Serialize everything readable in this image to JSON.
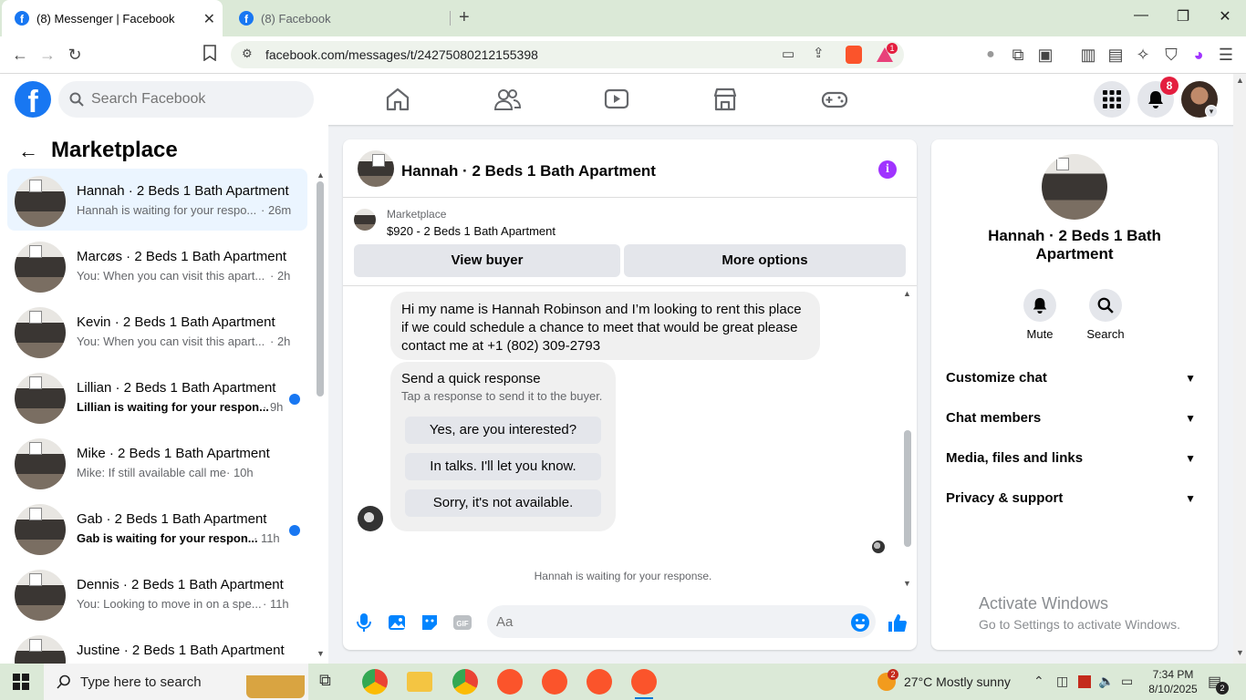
{
  "browser": {
    "tabs": [
      {
        "title": "(8) Messenger | Facebook",
        "active": true
      },
      {
        "title": "(8) Facebook",
        "active": false
      }
    ],
    "new_tab": "+",
    "url": "facebook.com/messages/t/24275080212155398",
    "brave_badge": "1",
    "window_controls": {
      "minimize": "—",
      "restore": "❐",
      "close": "✕"
    }
  },
  "fb_header": {
    "logo": "f",
    "search_placeholder": "Search Facebook",
    "nav_icons": [
      "home-icon",
      "friends-icon",
      "video-icon",
      "marketplace-icon",
      "gaming-icon"
    ],
    "notification_count": "8"
  },
  "sidebar": {
    "title": "Marketplace",
    "back": "←",
    "conversations": [
      {
        "name": "Hannah · 2 Beds 1 Bath Apartment",
        "snippet": "Hannah is waiting for your respo...",
        "time": "· 26m",
        "unread": false,
        "selected": true
      },
      {
        "name": "Marcøs · 2 Beds 1 Bath Apartment",
        "snippet": "You: When you can visit this apart...",
        "time": "· 2h",
        "unread": false,
        "selected": false
      },
      {
        "name": "Kevin · 2 Beds 1 Bath Apartment",
        "snippet": "You: When you can visit this apart...",
        "time": "· 2h",
        "unread": false,
        "selected": false
      },
      {
        "name": "Lillian · 2 Beds 1 Bath Apartment",
        "snippet": "Lillian is waiting for your respon...",
        "time": "· 9h",
        "unread": true,
        "selected": false
      },
      {
        "name": "Mike · 2 Beds 1 Bath Apartment",
        "snippet": "Mike: If still available call me",
        "time": "· 10h",
        "unread": false,
        "selected": false
      },
      {
        "name": "Gab · 2 Beds 1 Bath Apartment",
        "snippet": "Gab is waiting for your respon...",
        "time": "· 11h",
        "unread": true,
        "selected": false
      },
      {
        "name": "Dennis · 2 Beds 1 Bath Apartment",
        "snippet": "You: Looking to move in on a spe...",
        "time": "· 11h",
        "unread": false,
        "selected": false
      },
      {
        "name": "Justine · 2 Beds 1 Bath Apartment",
        "snippet": "",
        "time": "",
        "unread": false,
        "selected": false
      }
    ]
  },
  "chat": {
    "title": "Hannah · 2 Beds 1 Bath Apartment",
    "info": "i",
    "marketplace_label": "Marketplace",
    "listing": "$920 - 2 Beds 1 Bath Apartment",
    "view_buyer": "View buyer",
    "more_options": "More options",
    "message": "Hi my name is Hannah Robinson and I’m looking to rent this place if we could schedule a chance to meet that would be great please contact me at +1 (802) 309-2793",
    "quick_response": {
      "title": "Send a quick response",
      "subtitle": "Tap a response to send it to the buyer.",
      "options": [
        "Yes, are you interested?",
        "In talks. I'll let you know.",
        "Sorry, it's not available."
      ]
    },
    "waiting_notice": "Hannah is waiting for your response.",
    "input_placeholder": "Aa"
  },
  "details": {
    "name": "Hannah · 2 Beds 1 Bath Apartment",
    "actions": [
      {
        "label": "Mute",
        "icon": "bell-icon"
      },
      {
        "label": "Search",
        "icon": "search-icon"
      }
    ],
    "sections": [
      "Customize chat",
      "Chat members",
      "Media, files and links",
      "Privacy & support"
    ]
  },
  "watermark": {
    "line1": "Activate Windows",
    "line2": "Go to Settings to activate Windows."
  },
  "taskbar": {
    "search_placeholder": "Type here to search",
    "weather_badge": "2",
    "weather": "27°C  Mostly sunny",
    "time": "7:34 PM",
    "date": "8/10/2025",
    "notification_count": "2"
  }
}
